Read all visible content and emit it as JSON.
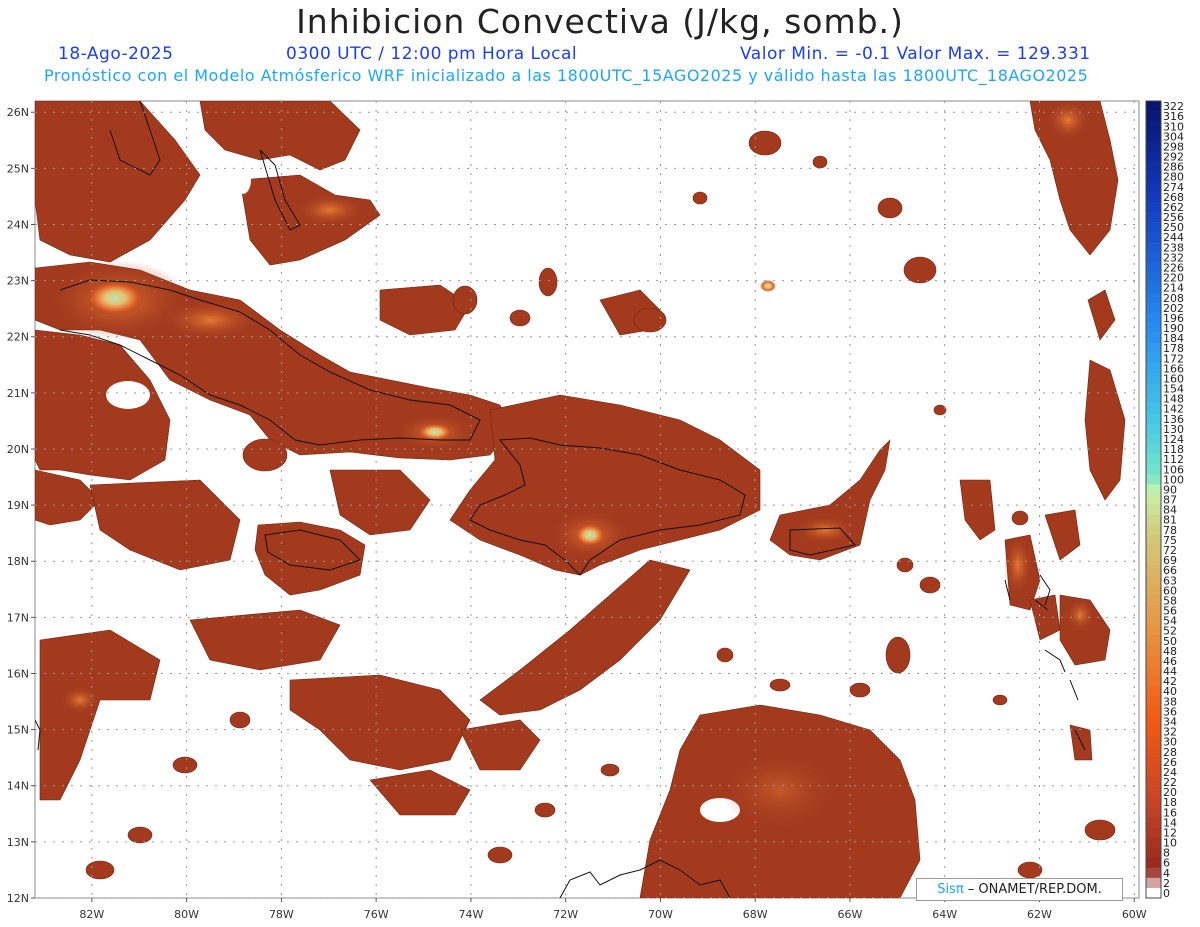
{
  "title": "Inhibicion Convectiva (J/kg, somb.)",
  "header": {
    "date": "18-Ago-2025",
    "time": "0300 UTC / 12:00 pm Hora Local",
    "min_max": "Valor Min. = -0.1  Valor Max. = 129.331",
    "forecast": "Pronóstico con el Modelo Atmósferico WRF inicializado a las 1800UTC_15AGO2025 y válido hasta las  1800UTC_18AGO2025"
  },
  "map": {
    "lon_range": [
      -83.2,
      -59.9
    ],
    "lat_range": [
      12,
      26.2
    ],
    "lon_ticks": [
      "82W",
      "80W",
      "78W",
      "76W",
      "74W",
      "72W",
      "70W",
      "68W",
      "66W",
      "64W",
      "62W",
      "60W"
    ],
    "lon_values": [
      -82,
      -80,
      -78,
      -76,
      -74,
      -72,
      -70,
      -68,
      -66,
      -64,
      -62,
      -60
    ],
    "lat_ticks": [
      "26N",
      "25N",
      "24N",
      "23N",
      "22N",
      "21N",
      "20N",
      "19N",
      "18N",
      "17N",
      "16N",
      "15N",
      "14N",
      "13N",
      "12N"
    ],
    "lat_values": [
      26,
      25,
      24,
      23,
      22,
      21,
      20,
      19,
      18,
      17,
      16,
      15,
      14,
      13,
      12
    ],
    "shading_color": "#a33a1e",
    "highlight_color": "#e8642a",
    "peak_color": "#a6e0b0"
  },
  "colorbar": {
    "labels": [
      "322",
      "316",
      "310",
      "304",
      "298",
      "292",
      "286",
      "280",
      "274",
      "268",
      "262",
      "256",
      "250",
      "244",
      "238",
      "232",
      "226",
      "220",
      "214",
      "208",
      "202",
      "196",
      "190",
      "184",
      "178",
      "172",
      "166",
      "160",
      "154",
      "148",
      "142",
      "136",
      "130",
      "124",
      "118",
      "112",
      "106",
      "100",
      "90",
      "87",
      "84",
      "81",
      "78",
      "75",
      "72",
      "69",
      "66",
      "63",
      "60",
      "58",
      "56",
      "54",
      "52",
      "50",
      "48",
      "46",
      "44",
      "42",
      "40",
      "38",
      "36",
      "34",
      "32",
      "30",
      "28",
      "26",
      "24",
      "22",
      "20",
      "18",
      "16",
      "14",
      "12",
      "10",
      "8",
      "6",
      "4",
      "2",
      "0"
    ]
  },
  "credit": {
    "sis": "Sisπ",
    "text": " – ONAMET/REP.DOM."
  }
}
